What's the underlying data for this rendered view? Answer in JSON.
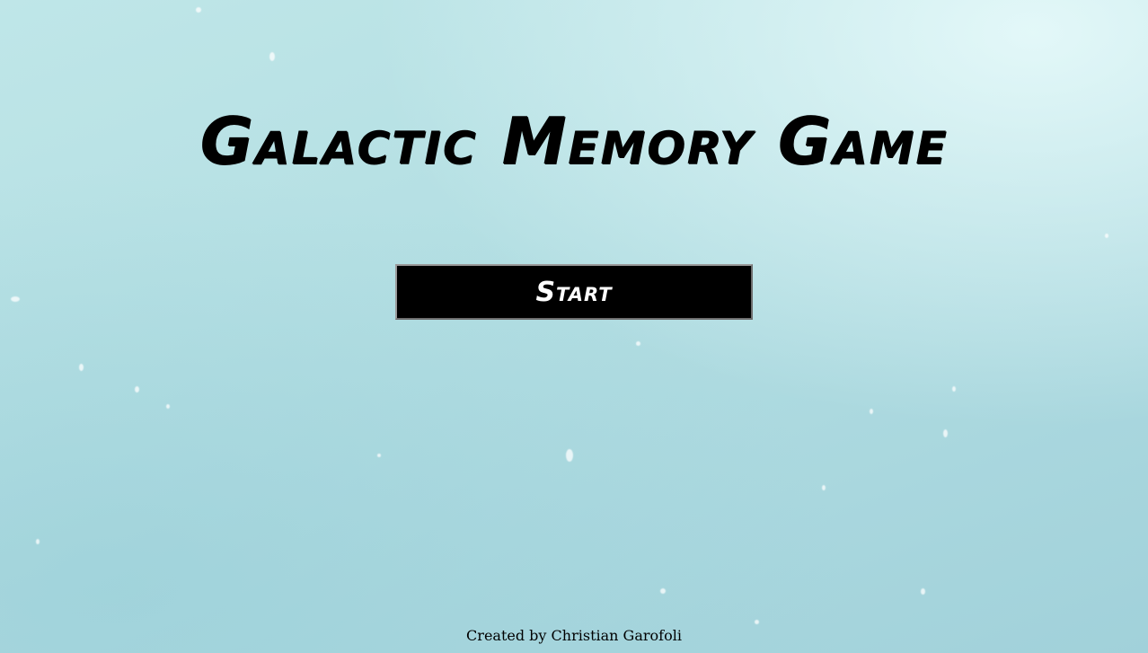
{
  "game": {
    "title": "Galactic Memory Game",
    "start_label": "Start"
  },
  "footer": {
    "credit": "Created by Christian Garofoli"
  },
  "colors": {
    "background": "#b4dfe3",
    "button_bg": "#000000",
    "button_text": "#ffffff",
    "title_text": "#000000"
  }
}
